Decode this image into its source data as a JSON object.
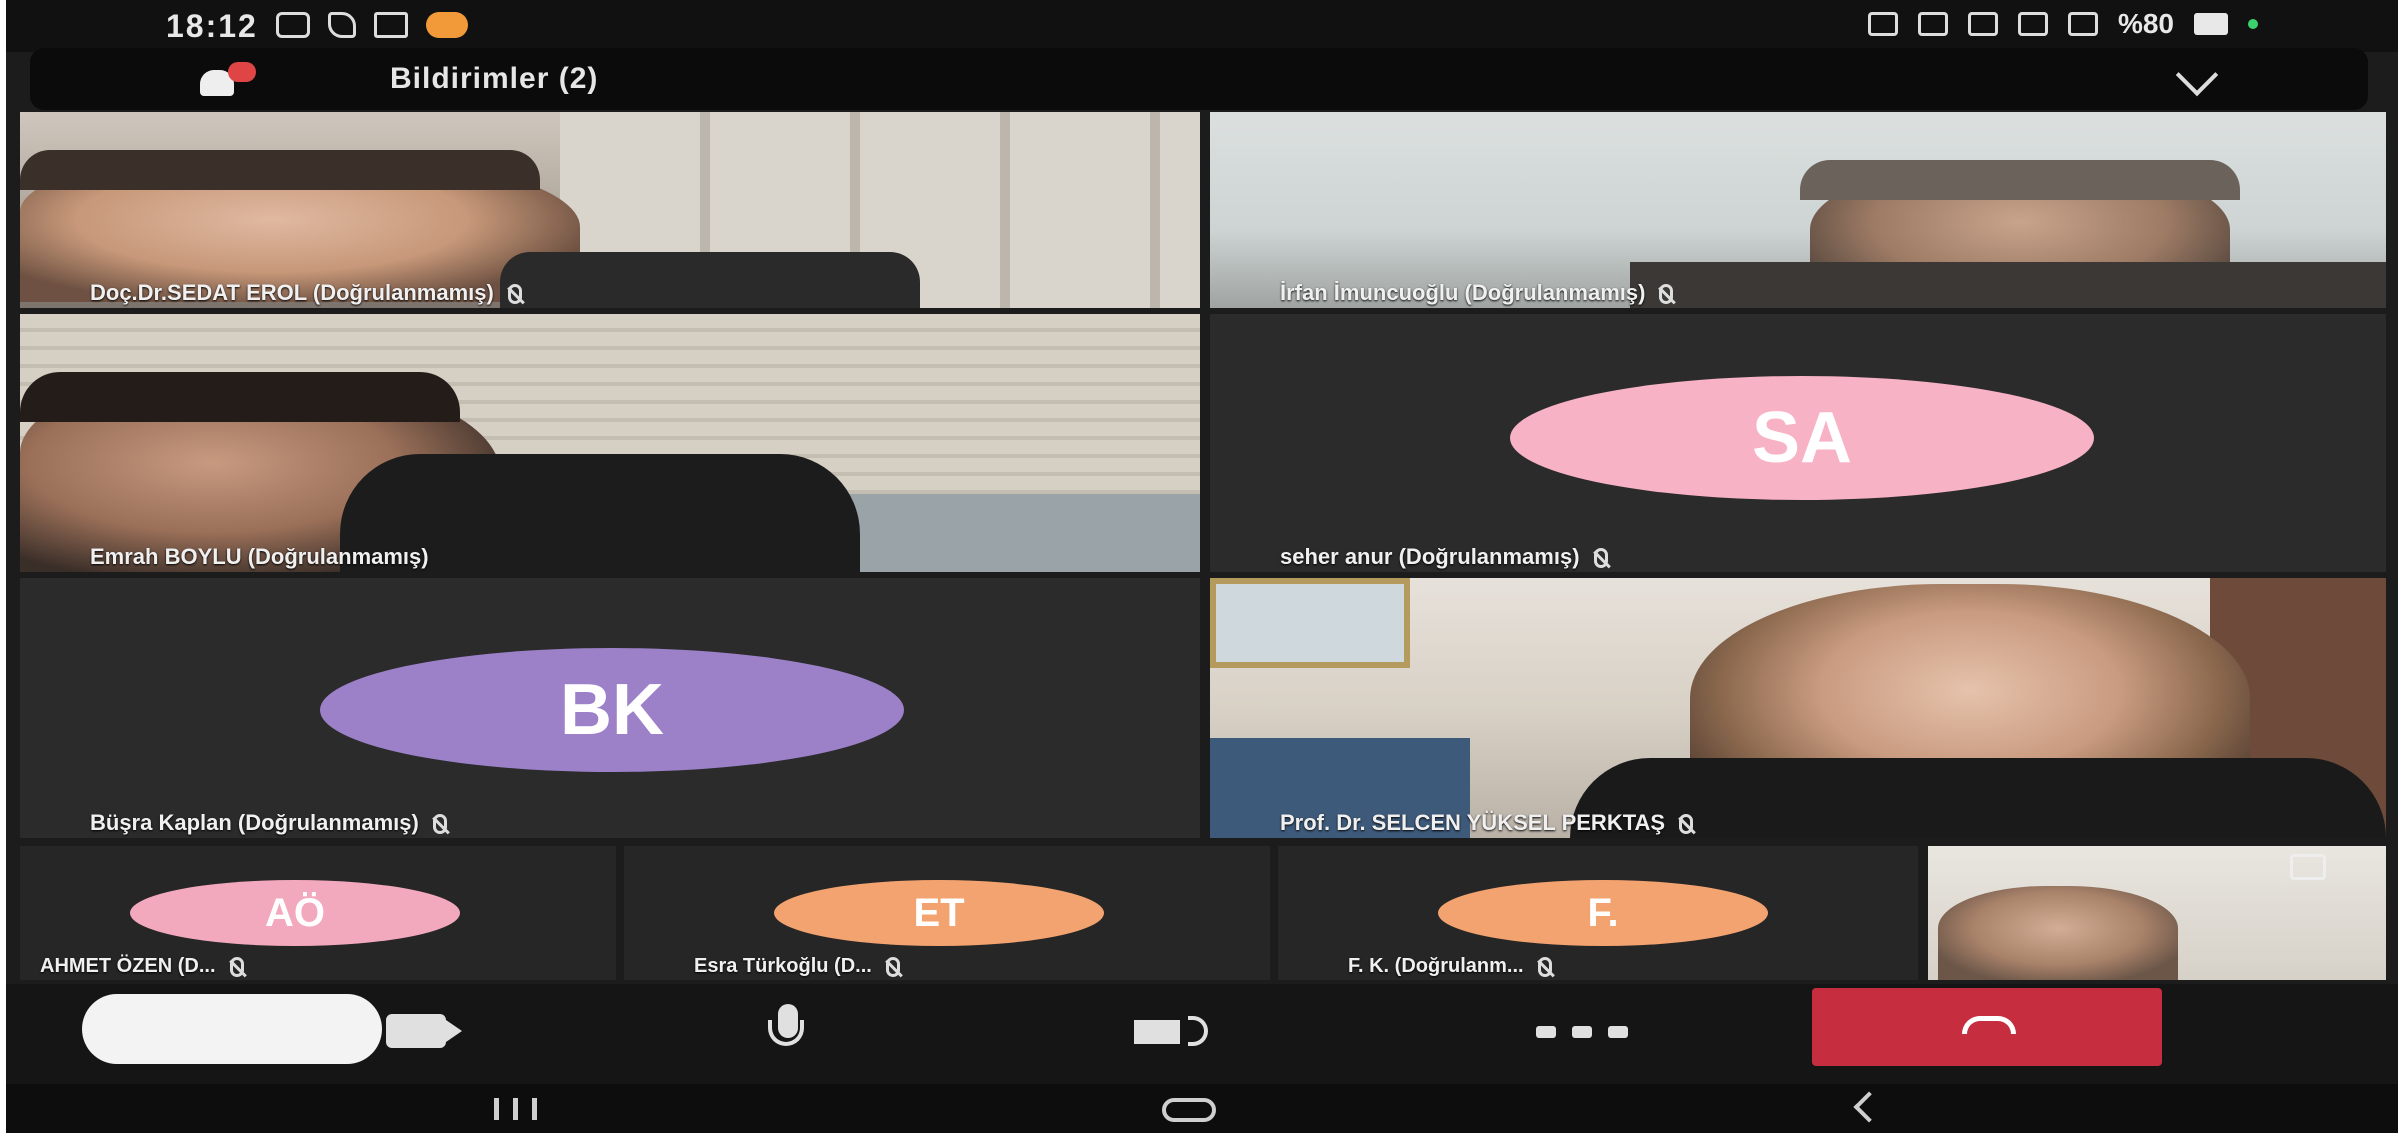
{
  "status_bar": {
    "time": "18:12",
    "battery": "%80"
  },
  "notifications": {
    "title": "Bildirimler (2)"
  },
  "participants": [
    {
      "name": "Doç.Dr.SEDAT EROL (Doğrulanmamış)",
      "muted": true
    },
    {
      "name": "İrfan İmuncuoğlu (Doğrulanmamış)",
      "muted": true
    },
    {
      "name": "Emrah BOYLU (Doğrulanmamış)",
      "muted": false
    },
    {
      "name": "seher anur (Doğrulanmamış)",
      "initials": "SA",
      "muted": true
    },
    {
      "name": "Büşra Kaplan (Doğrulanmamış)",
      "initials": "BK",
      "muted": true
    },
    {
      "name": "Prof. Dr. SELCEN YÜKSEL PERKTAŞ",
      "muted": true
    }
  ],
  "strip": [
    {
      "name": "AHMET ÖZEN (D...",
      "initials": "AÖ",
      "color": "#f3a9bd"
    },
    {
      "name": "Esra Türkoğlu (D...",
      "initials": "ET",
      "color": "#f2a36f"
    },
    {
      "name": "F. K. (Doğrulanm...",
      "initials": "F.",
      "color": "#f2a36f"
    }
  ],
  "colors": {
    "avatar_sa": "#f7b2c5",
    "avatar_bk": "#9c81c9",
    "hangup": "#c62d3f"
  },
  "icons": [
    "camera-icon",
    "microphone-icon",
    "speaker-icon",
    "more-icon",
    "hangup-icon",
    "bell-icon",
    "chevron-down-icon",
    "mic-off-icon"
  ]
}
